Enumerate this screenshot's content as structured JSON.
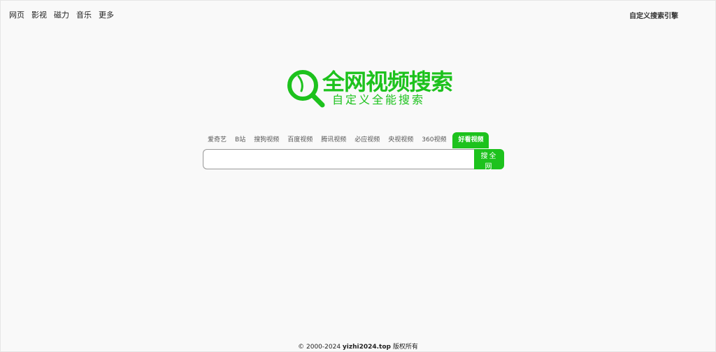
{
  "top_nav": {
    "items": [
      {
        "label": "网页"
      },
      {
        "label": "影视"
      },
      {
        "label": "磁力"
      },
      {
        "label": "音乐"
      },
      {
        "label": "更多"
      }
    ],
    "right_link": "自定义搜索引擎"
  },
  "logo": {
    "title": "全网视频搜索",
    "subtitle": "自定义全能搜索",
    "icon": "magnifier-icon",
    "color": "#1dc21d"
  },
  "tabs": [
    {
      "label": "爱奇艺"
    },
    {
      "label": "B站"
    },
    {
      "label": "搜狗视频"
    },
    {
      "label": "百度视频"
    },
    {
      "label": "腾讯视频"
    },
    {
      "label": "必应视频"
    },
    {
      "label": "央视视频"
    },
    {
      "label": "360视频"
    },
    {
      "label": "好看视频",
      "active": true
    }
  ],
  "search": {
    "value": "",
    "placeholder": "",
    "button_label": "搜全网"
  },
  "footer": {
    "prefix": "© 2000-2024 ",
    "site": "yizhi2024.top",
    "suffix": " 版权所有"
  },
  "colors": {
    "accent": "#1dc21d",
    "background": "#f9f9f9"
  }
}
